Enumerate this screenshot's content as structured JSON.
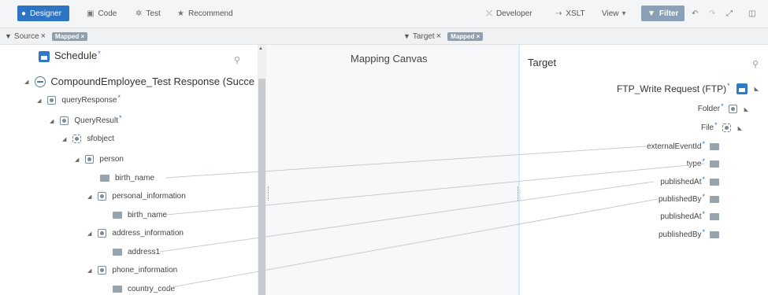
{
  "toolbar": {
    "designer": "Designer",
    "code": "Code",
    "test": "Test",
    "recommend": "Recommend",
    "developer": "Developer",
    "xslt": "XSLT",
    "view": "View",
    "filter": "Filter"
  },
  "source_filter": {
    "label": "Source",
    "chip": "Mapped"
  },
  "target_filter": {
    "label": "Target",
    "chip": "Mapped"
  },
  "source": {
    "title": "Schedule",
    "root": "CompoundEmployee_Test Response (Succe",
    "nodes": {
      "queryResponse": "queryResponse",
      "QueryResult": "QueryResult",
      "sfobject": "sfobject",
      "person": "person",
      "birth_name_1": "birth_name",
      "personal_information": "personal_information",
      "birth_name_2": "birth_name",
      "address_information": "address_information",
      "address1": "address1",
      "phone_information": "phone_information",
      "country_code": "country_code"
    }
  },
  "canvas": {
    "title": "Mapping Canvas"
  },
  "target": {
    "title": "Target",
    "root": "FTP_Write Request (FTP)",
    "nodes": {
      "folder": "Folder",
      "file": "File",
      "externalEventId": "externalEventId",
      "type": "type",
      "publishedAt_1": "publishedAt",
      "publishedBy_1": "publishedBy",
      "publishedAt_2": "publishedAt",
      "publishedBy_2": "publishedBy"
    }
  },
  "colors": {
    "accent": "#2d74c5",
    "required": "#2d74c5",
    "chip": "#8f9fae"
  }
}
